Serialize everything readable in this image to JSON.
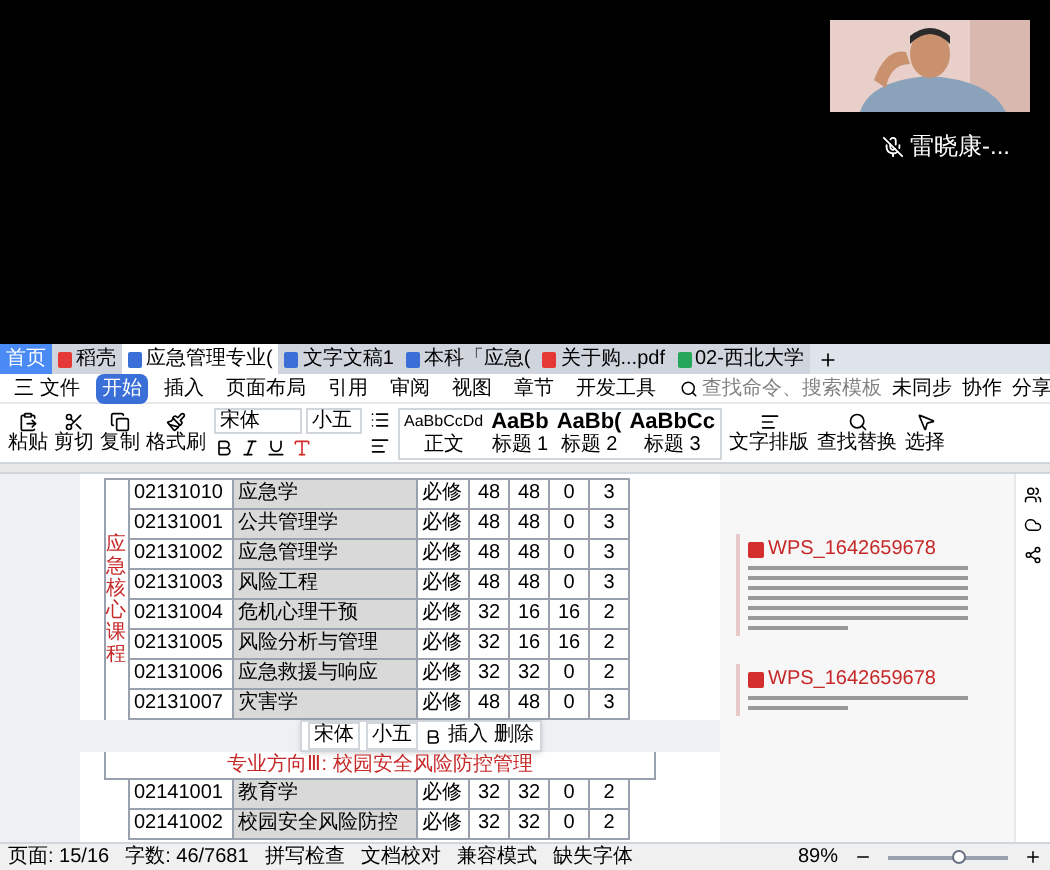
{
  "call": {
    "speaker": "雷晓康-...",
    "muted": true
  },
  "tabs": [
    {
      "label": "首页",
      "kind": "home",
      "selected": false
    },
    {
      "label": "稻壳",
      "kind": "docer",
      "selected": false
    },
    {
      "label": "应急管理专业(",
      "kind": "doc",
      "selected": true
    },
    {
      "label": "文字文稿1",
      "kind": "doc",
      "selected": false
    },
    {
      "label": "本科「应急(",
      "kind": "doc",
      "selected": false
    },
    {
      "label": "关于购...pdf",
      "kind": "pdf",
      "selected": false
    },
    {
      "label": "02-西北大学",
      "kind": "sheet",
      "selected": false
    }
  ],
  "menu": [
    {
      "label": "三 文件",
      "selected": false
    },
    {
      "label": "开始",
      "selected": true
    },
    {
      "label": "插入",
      "selected": false
    },
    {
      "label": "页面布局",
      "selected": false
    },
    {
      "label": "引用",
      "selected": false
    },
    {
      "label": "审阅",
      "selected": false
    },
    {
      "label": "视图",
      "selected": false
    },
    {
      "label": "章节",
      "selected": false
    },
    {
      "label": "开发工具",
      "selected": false
    }
  ],
  "search": {
    "placeholder": "查找命令、搜索模板"
  },
  "menu_right": [
    "未同步",
    "协作",
    "分享"
  ],
  "toolbar": {
    "clipboard": [
      "粘贴",
      "剪切",
      "复制",
      "格式刷"
    ],
    "font": "宋体",
    "size": "小五",
    "styles": [
      {
        "preview": "AaBbCcDd",
        "label": "正文"
      },
      {
        "preview": "AaBb",
        "label": "标题 1"
      },
      {
        "preview": "AaBb(",
        "label": "标题 2"
      },
      {
        "preview": "AaBbCc",
        "label": "标题 3"
      }
    ],
    "tools": [
      "文字排版",
      "查找替换",
      "选择"
    ]
  },
  "table": {
    "group_label": "应急核心课程",
    "rows": [
      [
        "02131010",
        "应急学",
        "必修",
        "48",
        "48",
        "0",
        "3"
      ],
      [
        "02131001",
        "公共管理学",
        "必修",
        "48",
        "48",
        "0",
        "3"
      ],
      [
        "02131002",
        "应急管理学",
        "必修",
        "48",
        "48",
        "0",
        "3"
      ],
      [
        "02131003",
        "风险工程",
        "必修",
        "48",
        "48",
        "0",
        "3"
      ],
      [
        "02131004",
        "危机心理干预",
        "必修",
        "32",
        "16",
        "16",
        "2"
      ],
      [
        "02131005",
        "风险分析与管理",
        "必修",
        "32",
        "16",
        "16",
        "2"
      ],
      [
        "02131006",
        "应急救援与响应",
        "必修",
        "32",
        "32",
        "0",
        "2"
      ],
      [
        "02131007",
        "灾害学",
        "必修",
        "48",
        "48",
        "0",
        "3"
      ]
    ],
    "section": "专业方向Ⅲ: 校园安全风险防控管理",
    "rows2": [
      [
        "02141001",
        "教育学",
        "必修",
        "32",
        "32",
        "0",
        "2"
      ],
      [
        "02141002",
        "校园安全风险防控",
        "必修",
        "32",
        "32",
        "0",
        "2"
      ]
    ]
  },
  "mini_toolbar": {
    "font": "宋体",
    "size": "小五",
    "actions": [
      "插入",
      "删除"
    ]
  },
  "comments": [
    {
      "author": "WPS_1642659678",
      "kind": "long"
    },
    {
      "author": "WPS_1642659678",
      "kind": "short"
    }
  ],
  "status": {
    "page": "页面: 15/16",
    "words": "字数: 46/7681",
    "items": [
      "拼写检查",
      "文档校对",
      "兼容模式",
      "缺失字体"
    ],
    "zoom": "89%",
    "level": 0.6
  }
}
